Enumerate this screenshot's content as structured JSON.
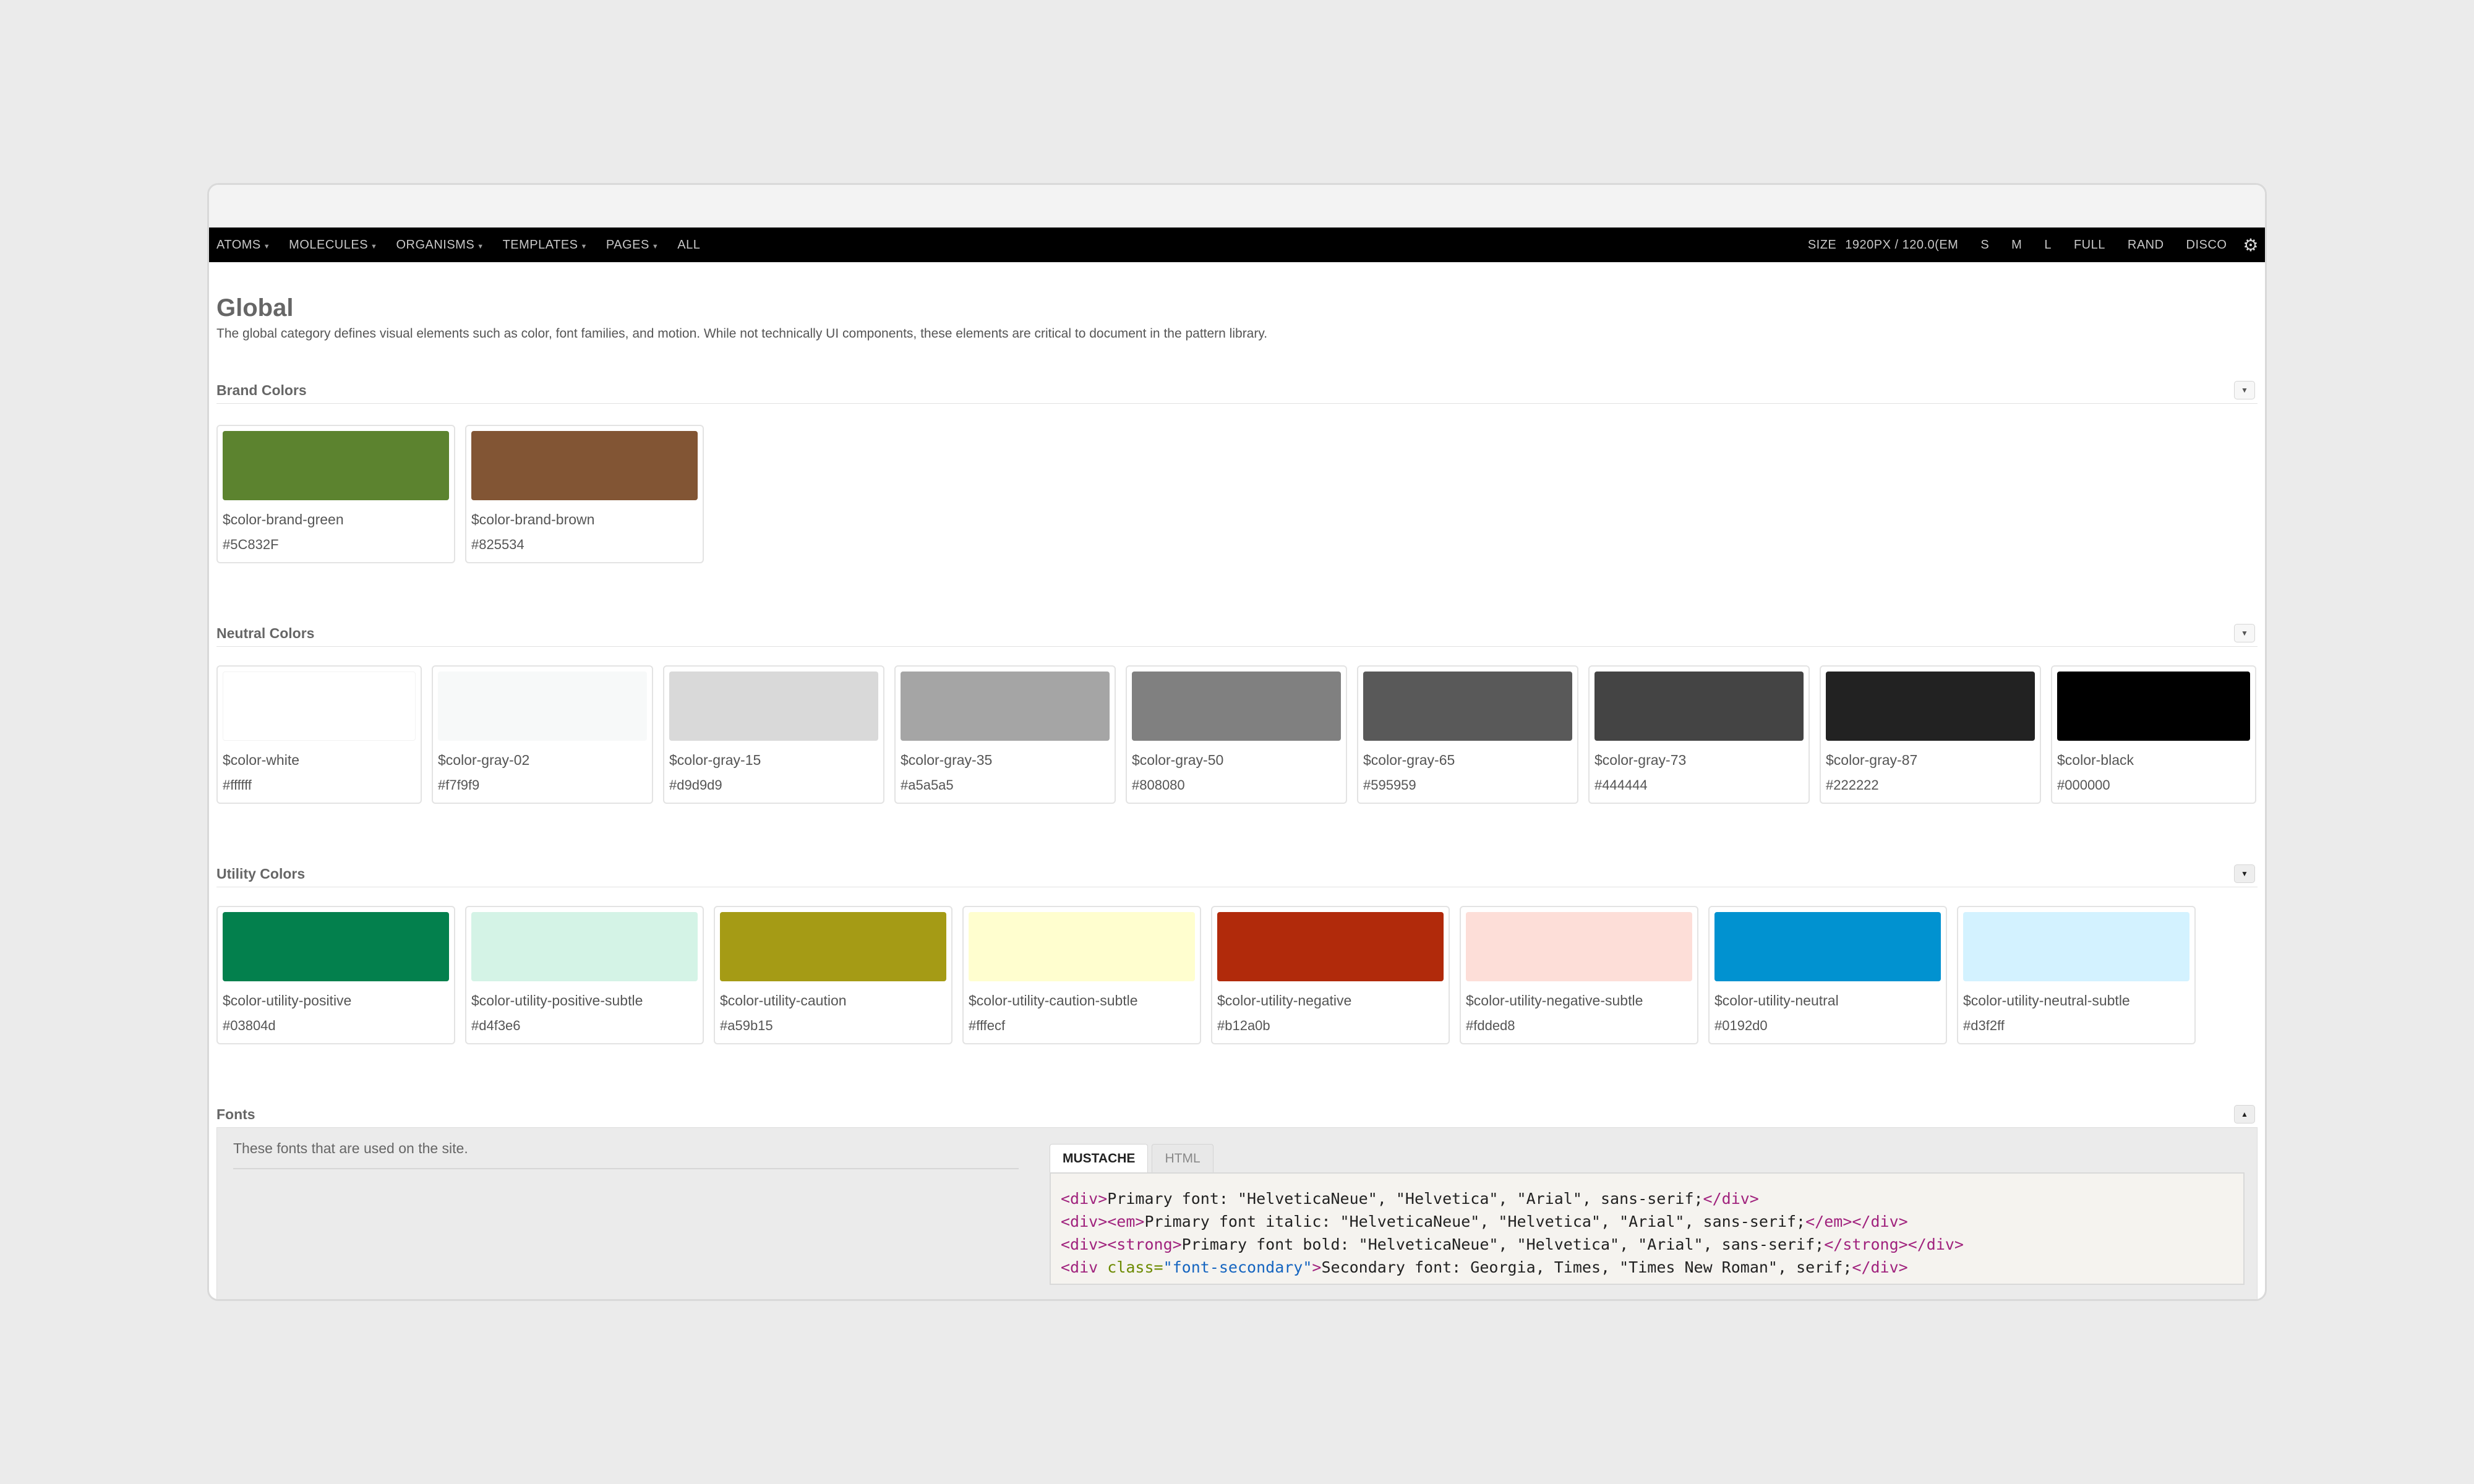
{
  "nav": {
    "left_items": [
      {
        "label": "ATOMS",
        "caret": true
      },
      {
        "label": "MOLECULES",
        "caret": true
      },
      {
        "label": "ORGANISMS",
        "caret": true
      },
      {
        "label": "TEMPLATES",
        "caret": true
      },
      {
        "label": "PAGES",
        "caret": true
      },
      {
        "label": "ALL",
        "caret": false
      }
    ],
    "size_label": "SIZE",
    "size_value": "1920PX / 120.0(EM",
    "right_items": [
      "S",
      "M",
      "L",
      "FULL",
      "RAND",
      "DISCO"
    ],
    "settings_icon": "gear-icon"
  },
  "page": {
    "title": "Global",
    "description": "The global category defines visual elements such as color, font families, and motion. While not technically UI components, these elements are critical to document in the pattern library."
  },
  "sections": {
    "brand": {
      "title": "Brand Colors",
      "swatches": [
        {
          "name": "$color-brand-green",
          "hex": "#5C832F",
          "color": "#5C832F"
        },
        {
          "name": "$color-brand-brown",
          "hex": "#825534",
          "color": "#825534"
        }
      ]
    },
    "neutral": {
      "title": "Neutral Colors",
      "swatches": [
        {
          "name": "$color-white",
          "hex": "#ffffff",
          "color": "#ffffff"
        },
        {
          "name": "$color-gray-02",
          "hex": "#f7f9f9",
          "color": "#f7f9f9"
        },
        {
          "name": "$color-gray-15",
          "hex": "#d9d9d9",
          "color": "#d9d9d9"
        },
        {
          "name": "$color-gray-35",
          "hex": "#a5a5a5",
          "color": "#a5a5a5"
        },
        {
          "name": "$color-gray-50",
          "hex": "#808080",
          "color": "#808080"
        },
        {
          "name": "$color-gray-65",
          "hex": "#595959",
          "color": "#595959"
        },
        {
          "name": "$color-gray-73",
          "hex": "#444444",
          "color": "#444444"
        },
        {
          "name": "$color-gray-87",
          "hex": "#222222",
          "color": "#222222"
        },
        {
          "name": "$color-black",
          "hex": "#000000",
          "color": "#000000"
        }
      ]
    },
    "utility": {
      "title": "Utility Colors",
      "swatches": [
        {
          "name": "$color-utility-positive",
          "hex": "#03804d",
          "color": "#03804d"
        },
        {
          "name": "$color-utility-positive-subtle",
          "hex": "#d4f3e6",
          "color": "#d4f3e6"
        },
        {
          "name": "$color-utility-caution",
          "hex": "#a59b15",
          "color": "#a59b15"
        },
        {
          "name": "$color-utility-caution-subtle",
          "hex": "#fffecf",
          "color": "#fffecf"
        },
        {
          "name": "$color-utility-negative",
          "hex": "#b12a0b",
          "color": "#b12a0b"
        },
        {
          "name": "$color-utility-negative-subtle",
          "hex": "#fdded8",
          "color": "#fdded8"
        },
        {
          "name": "$color-utility-neutral",
          "hex": "#0192d0",
          "color": "#0192d0"
        },
        {
          "name": "$color-utility-neutral-subtle",
          "hex": "#d3f2ff",
          "color": "#d3f2ff"
        }
      ]
    },
    "fonts": {
      "title": "Fonts",
      "description": "These fonts that are used on the site.",
      "tabs": {
        "mustache": "MUSTACHE",
        "html": "HTML"
      },
      "code": {
        "line1_text": "Primary font: \"HelveticaNeue\", \"Helvetica\", \"Arial\", sans-serif;",
        "line2_text": "Primary font italic: \"HelveticaNeue\", \"Helvetica\", \"Arial\", sans-serif;",
        "line3_text": "Primary font bold: \"HelveticaNeue\", \"Helvetica\", \"Arial\", sans-serif;",
        "line4_text": "Secondary font: Georgia, Times, \"Times New Roman\", serif;",
        "line4_class_value": "\"font-secondary\""
      }
    }
  }
}
